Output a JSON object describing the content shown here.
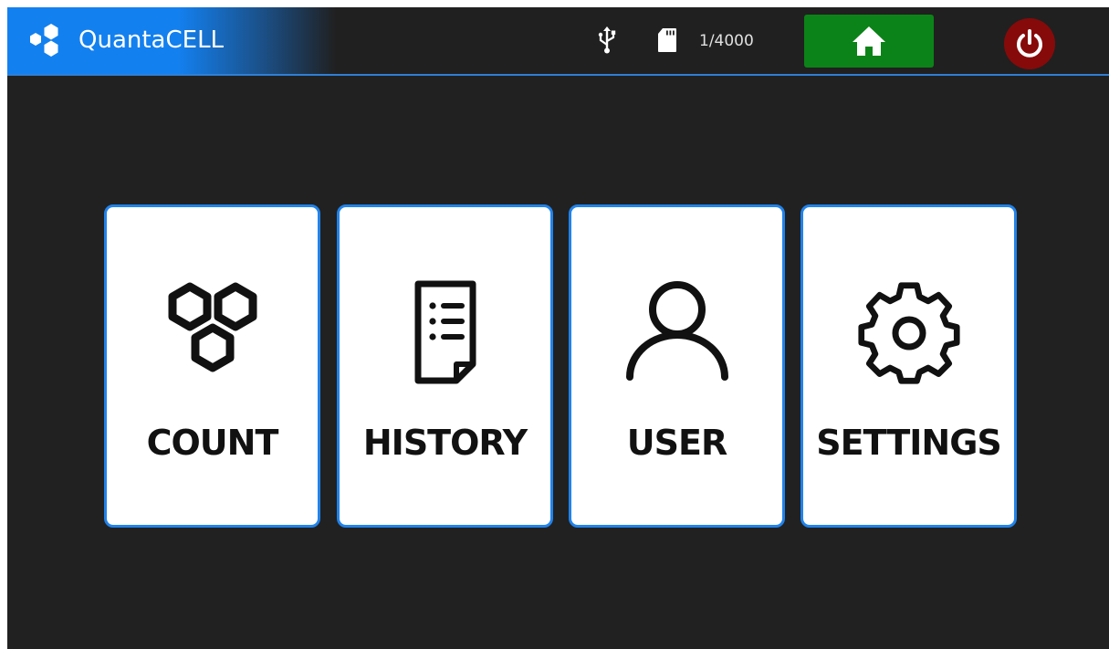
{
  "header": {
    "brand": "QuantaCELL",
    "logo_icon": "hexagon-cluster-logo-icon",
    "usb_icon": "usb-icon",
    "storage_icon": "sd-card-icon",
    "record_count": "1/4000",
    "home_icon": "home-icon",
    "power_icon": "power-icon",
    "colors": {
      "brand_blue": "#1380ef",
      "home_green": "#0c8318",
      "power_red": "#860a0a",
      "tile_border": "#2183ea",
      "background": "#212121"
    }
  },
  "menu": {
    "tiles": [
      {
        "label": "COUNT",
        "icon": "hexagon-cells-icon"
      },
      {
        "label": "HISTORY",
        "icon": "document-list-icon"
      },
      {
        "label": "USER",
        "icon": "user-icon"
      },
      {
        "label": "SETTINGS",
        "icon": "gear-icon"
      }
    ]
  }
}
